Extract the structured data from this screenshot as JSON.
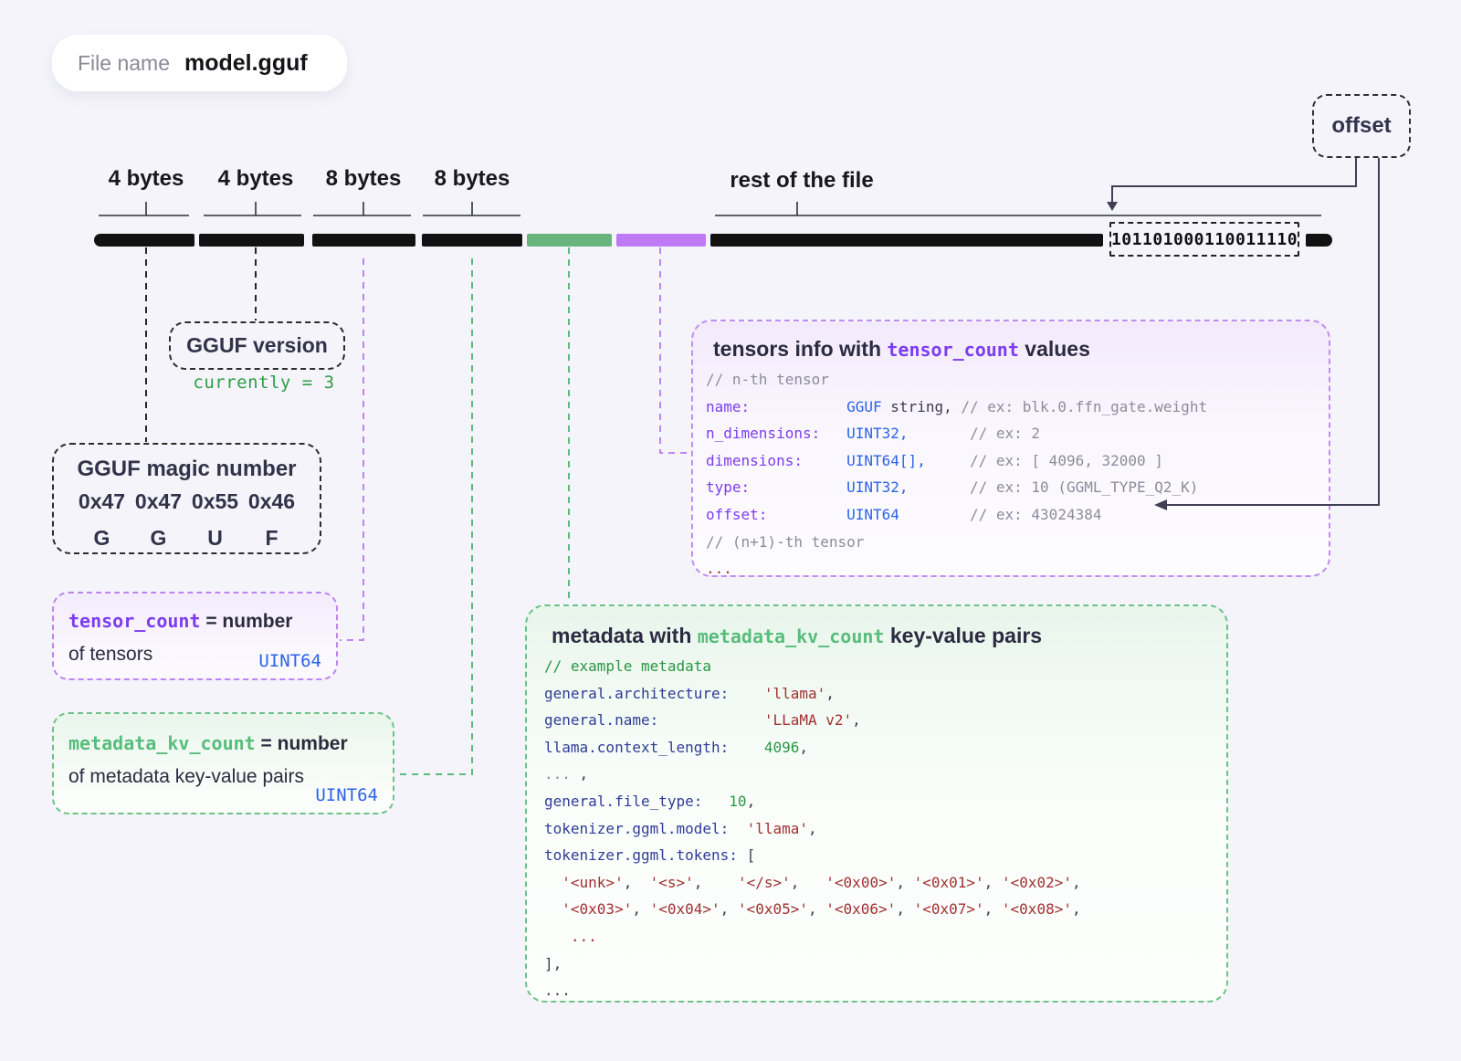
{
  "file_pill": {
    "label": "File name",
    "value": "model.gguf"
  },
  "offset_box": {
    "label": "offset"
  },
  "bar": {
    "labels": [
      "4 bytes",
      "4 bytes",
      "8 bytes",
      "8 bytes"
    ],
    "rest_label": "rest of the file",
    "binary": "101101000110011110"
  },
  "version_box": {
    "title": "GGUF version",
    "note": "currently = 3"
  },
  "magic_box": {
    "title": "GGUF magic number",
    "bytes": [
      "0x47",
      "0x47",
      "0x55",
      "0x46"
    ],
    "chars": [
      "G",
      "G",
      "U",
      "F"
    ]
  },
  "tensor_count_box": {
    "mono": "tensor_count",
    "eq": " = number",
    "line2": "of tensors",
    "type": "UINT64"
  },
  "metadata_kv_box": {
    "mono": "metadata_kv_count",
    "eq": " = number",
    "line2": "of metadata key-value pairs",
    "type": "UINT64"
  },
  "tensors_box": {
    "title_pre": "tensors info with ",
    "title_mono": "tensor_count",
    "title_post": " values",
    "lines": [
      [
        {
          "t": "// n-th tensor",
          "c": "gray"
        }
      ],
      [
        {
          "t": "name:           ",
          "c": "purple"
        },
        {
          "t": "GGUF ",
          "c": "blue"
        },
        {
          "t": "string, ",
          "c": "dark"
        },
        {
          "t": "// ex: blk.0.ffn_gate.weight",
          "c": "gray"
        }
      ],
      [
        {
          "t": "n_dimensions:   ",
          "c": "purple"
        },
        {
          "t": "UINT32,       ",
          "c": "blue"
        },
        {
          "t": "// ex: 2",
          "c": "gray"
        }
      ],
      [
        {
          "t": "dimensions:     ",
          "c": "purple"
        },
        {
          "t": "UINT64[],     ",
          "c": "blue"
        },
        {
          "t": "// ex: [ 4096, 32000 ]",
          "c": "gray"
        }
      ],
      [
        {
          "t": "type:           ",
          "c": "purple"
        },
        {
          "t": "UINT32,       ",
          "c": "blue"
        },
        {
          "t": "// ex: 10 (GGML_TYPE_Q2_K)",
          "c": "gray"
        }
      ],
      [
        {
          "t": "offset:         ",
          "c": "purple"
        },
        {
          "t": "UINT64        ",
          "c": "blue"
        },
        {
          "t": "// ex: 43024384",
          "c": "gray"
        }
      ],
      [
        {
          "t": "// (n+1)-th tensor",
          "c": "gray"
        }
      ],
      [
        {
          "t": "...",
          "c": "red"
        }
      ]
    ]
  },
  "metadata_box": {
    "title_pre": "metadata with ",
    "title_mono": "metadata_kv_count",
    "title_post": " key-value pairs",
    "lines": [
      [
        {
          "t": "// example metadata",
          "c": "green"
        }
      ],
      [
        {
          "t": "general.architecture:    ",
          "c": "navy"
        },
        {
          "t": "'llama'",
          "c": "red"
        },
        {
          "t": ",",
          "c": "dark"
        }
      ],
      [
        {
          "t": "general.name:            ",
          "c": "navy"
        },
        {
          "t": "'LLaMA v2'",
          "c": "red"
        },
        {
          "t": ",",
          "c": "dark"
        }
      ],
      [
        {
          "t": "llama.context_length:    ",
          "c": "navy"
        },
        {
          "t": "4096",
          "c": "green"
        },
        {
          "t": ",",
          "c": "dark"
        }
      ],
      [
        {
          "t": "...",
          "c": "gray"
        },
        {
          "t": " ,",
          "c": "dark"
        }
      ],
      [
        {
          "t": "general.file_type:   ",
          "c": "navy"
        },
        {
          "t": "10",
          "c": "green"
        },
        {
          "t": ",",
          "c": "dark"
        }
      ],
      [
        {
          "t": "tokenizer.ggml.model:  ",
          "c": "navy"
        },
        {
          "t": "'llama'",
          "c": "red"
        },
        {
          "t": ",",
          "c": "dark"
        }
      ],
      [
        {
          "t": "tokenizer.ggml.tokens: ",
          "c": "navy"
        },
        {
          "t": "[",
          "c": "dark"
        }
      ],
      [
        {
          "t": "  ",
          "c": "dark"
        },
        {
          "t": "'<unk>'",
          "c": "red"
        },
        {
          "t": ",  ",
          "c": "dark"
        },
        {
          "t": "'<s>'",
          "c": "red"
        },
        {
          "t": ",    ",
          "c": "dark"
        },
        {
          "t": "'</s>'",
          "c": "red"
        },
        {
          "t": ",   ",
          "c": "dark"
        },
        {
          "t": "'<0x00>'",
          "c": "red"
        },
        {
          "t": ", ",
          "c": "dark"
        },
        {
          "t": "'<0x01>'",
          "c": "red"
        },
        {
          "t": ", ",
          "c": "dark"
        },
        {
          "t": "'<0x02>'",
          "c": "red"
        },
        {
          "t": ",",
          "c": "dark"
        }
      ],
      [
        {
          "t": "  ",
          "c": "dark"
        },
        {
          "t": "'<0x03>'",
          "c": "red"
        },
        {
          "t": ", ",
          "c": "dark"
        },
        {
          "t": "'<0x04>'",
          "c": "red"
        },
        {
          "t": ", ",
          "c": "dark"
        },
        {
          "t": "'<0x05>'",
          "c": "red"
        },
        {
          "t": ", ",
          "c": "dark"
        },
        {
          "t": "'<0x06>'",
          "c": "red"
        },
        {
          "t": ", ",
          "c": "dark"
        },
        {
          "t": "'<0x07>'",
          "c": "red"
        },
        {
          "t": ", ",
          "c": "dark"
        },
        {
          "t": "'<0x08>'",
          "c": "red"
        },
        {
          "t": ",",
          "c": "dark"
        }
      ],
      [
        {
          "t": "   ",
          "c": "dark"
        },
        {
          "t": "...",
          "c": "red"
        }
      ],
      [
        {
          "t": "],",
          "c": "dark"
        }
      ],
      [
        {
          "t": "...",
          "c": "dark"
        }
      ]
    ]
  },
  "colors": {
    "page_bg": "#f4f4fa",
    "bar_black": "#121212",
    "bar_green": "#69b47d",
    "bar_purple": "#be7af5",
    "code_purple": "#7d3cf0",
    "code_blue": "#2b63e8",
    "code_navy": "#2f3c96",
    "code_red": "#a03030",
    "code_green_dark": "#2a9643",
    "code_green_light": "#58bd7c",
    "comment_gray": "#8c8c9a"
  }
}
